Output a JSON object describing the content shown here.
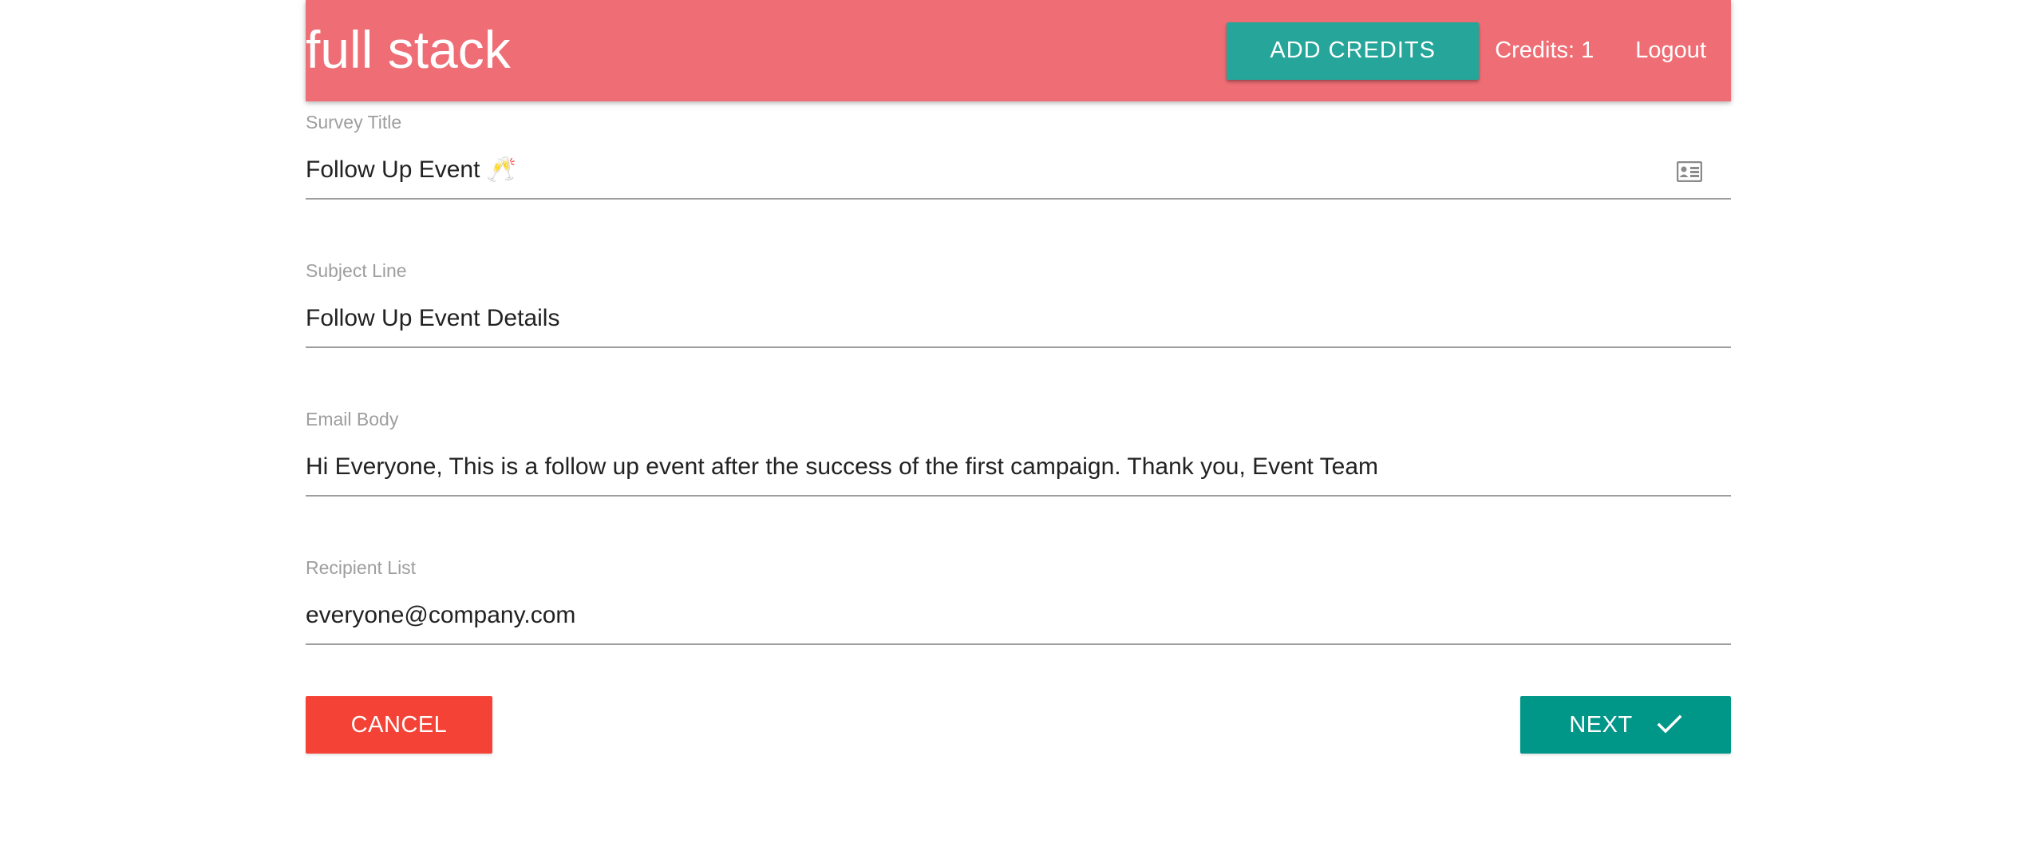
{
  "header": {
    "brand": "full stack",
    "add_credits_label": "ADD CREDITS",
    "credits_text": "Credits: 1",
    "logout_label": "Logout",
    "background_color": "#ef6e75",
    "button_color": "#26a69a"
  },
  "form": {
    "fields": [
      {
        "label": "Survey Title",
        "value": "Follow Up Event",
        "emoji": "🥂",
        "icon": "contact-card-icon"
      },
      {
        "label": "Subject Line",
        "value": "Follow Up Event Details"
      },
      {
        "label": "Email Body",
        "value": "Hi Everyone, This is a follow up event after the success of the first campaign. Thank you, Event Team"
      },
      {
        "label": "Recipient List",
        "value": "everyone@company.com"
      }
    ],
    "cancel_label": "CANCEL",
    "next_label": "NEXT",
    "next_icon": "check-icon",
    "cancel_color": "#f44336",
    "next_color": "#009688"
  }
}
